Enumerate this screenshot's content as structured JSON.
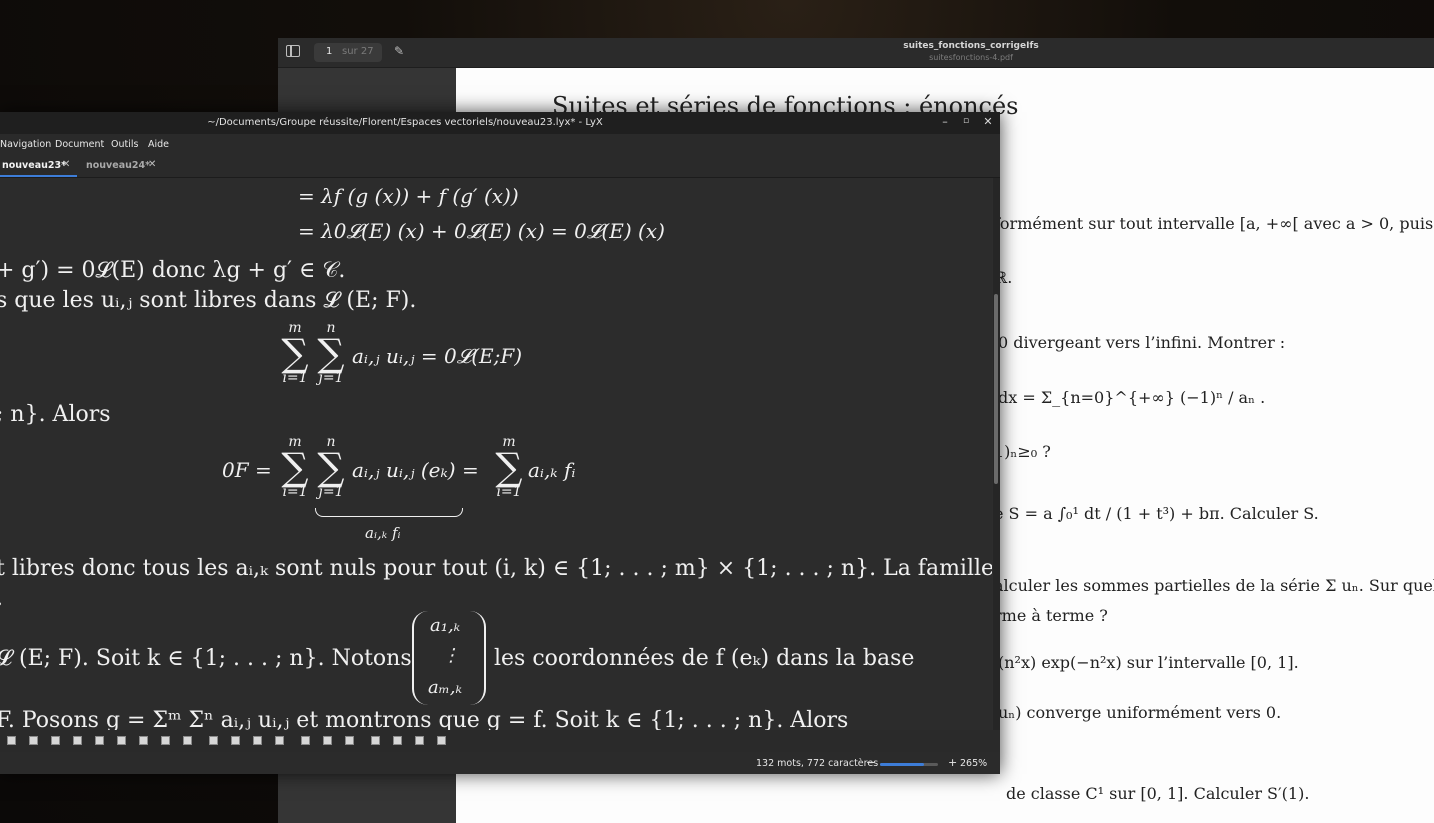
{
  "pdf_viewer": {
    "page_current": "1",
    "page_total": "sur 27",
    "title": "suites_fonctions_corrigeIfs",
    "filename": "suitesfonctions-4.pdf",
    "heading": "Suites et séries de fonctions : énoncés",
    "lines": [
      "formément sur tout intervalle [a, +∞[ avec a > 0, puis",
      "ℝ.",
      "0 divergeant vers l’infini. Montrer :",
      "dx = Σ_{n=0}^{+∞} (−1)ⁿ / aₙ .",
      "1)ₙ≥₀ ?",
      "e S = a ∫₀¹ dt / (1 + t³) + bπ. Calculer S.",
      "alculer les sommes partielles de la série Σ uₙ. Sur quels",
      "rme à terme ?",
      "(n²x) exp(−n²x) sur l’intervalle [0, 1].",
      "uₙ) converge uniformément vers 0.",
      "de classe C¹ sur [0, 1]. Calculer S′(1)."
    ]
  },
  "lyx": {
    "title": "~/Documents/Groupe réussite/Florent/Espaces vectoriels/nouveau23.lyx* - LyX",
    "menu": [
      "Navigation",
      "Document",
      "Outils",
      "Aide"
    ],
    "tabs": [
      {
        "label": "nouveau23*",
        "active": true
      },
      {
        "label": "nouveau24*",
        "active": false
      }
    ],
    "content": {
      "eq1": "= λf (g (x)) + f (g′ (x))",
      "eq2": "= λ0𝓛(E) (x) + 0𝓛(E) (x) = 0𝓛(E) (x)",
      "line1": "+ g′) = 0𝓛(E) donc λg + g′ ∈ 𝒞.",
      "line2": "s que les uᵢ,ⱼ sont libres dans 𝓛 (E; F).",
      "sum1_i_top": "m",
      "sum1_i_bot": "i=1",
      "sum1_j_top": "n",
      "sum1_j_bot": "j=1",
      "sum1_rest": "aᵢ,ⱼ uᵢ,ⱼ = 0𝓛(E;F)",
      "line3": "; n}. Alors",
      "sum2_lhs": "0F =",
      "sum2_mid": "aᵢ,ⱼ uᵢ,ⱼ (eₖ) =",
      "sum2_rest": "aᵢ,ₖ fᵢ",
      "sum2_underbrace": "aᵢ,ₖ fᵢ",
      "line4": "t libres donc tous les aᵢ,ₖ sont nuls pour tout (i, k) ∈ {1; . . . ; m} × {1; . . . ; n}. La famille",
      "line4b": ".",
      "line5_left": "𝓛 (E; F). Soit  k ∈ {1; . . . ; n}. Notons",
      "matrix_top": "a₁,ₖ",
      "matrix_mid": "⋮",
      "matrix_bot": "aₘ,ₖ",
      "line5_right": "les coordonnées de  f (eₖ) dans la base",
      "line6": "F. Posons  g = Σᵐ  Σⁿ  aᵢ,ⱼ uᵢ,ⱼ et montrons que  g = f. Soit  k ∈ {1; . . . ; n}. Alors"
    },
    "status": {
      "word_count": "132 mots, 772 caractères",
      "zoom_minus": "−",
      "zoom_plus": "+",
      "zoom": "265%",
      "zoom_fraction": 0.75
    }
  }
}
